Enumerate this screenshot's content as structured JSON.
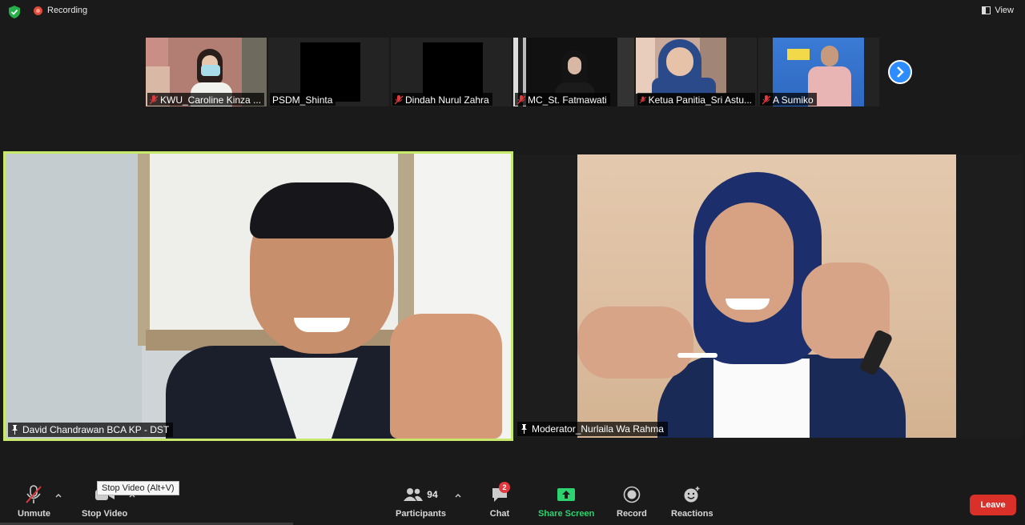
{
  "topbar": {
    "recording_label": "Recording",
    "view_label": "View"
  },
  "thumbnails": [
    {
      "name": "KWU_Caroline Kinza ...",
      "muted": true,
      "video": true
    },
    {
      "name": "PSDM_Shinta",
      "muted": false,
      "video": false
    },
    {
      "name": "Dindah Nurul Zahra",
      "muted": true,
      "video": false
    },
    {
      "name": "MC_St. Fatmawati",
      "muted": true,
      "video": true
    },
    {
      "name": "Ketua Panitia_Sri Astu...",
      "muted": true,
      "video": true
    },
    {
      "name": "A Sumiko",
      "muted": true,
      "video": true
    }
  ],
  "main_videos": {
    "left": {
      "name": "David Chandrawan BCA KP - DST"
    },
    "right": {
      "name": "Moderator_Nurlaila Wa Rahma"
    }
  },
  "toolbar": {
    "unmute_label": "Unmute",
    "stop_video_label": "Stop Video",
    "stop_video_tooltip": "Stop Video (Alt+V)",
    "participants_label": "Participants",
    "participants_count": "94",
    "chat_label": "Chat",
    "chat_badge": "2",
    "share_label": "Share Screen",
    "record_label": "Record",
    "reactions_label": "Reactions",
    "leave_label": "Leave"
  },
  "colors": {
    "active_speaker_border": "#c7e86b",
    "share_green": "#2dd36f",
    "leave_red": "#d9302a",
    "accent_blue": "#2d8cff"
  }
}
